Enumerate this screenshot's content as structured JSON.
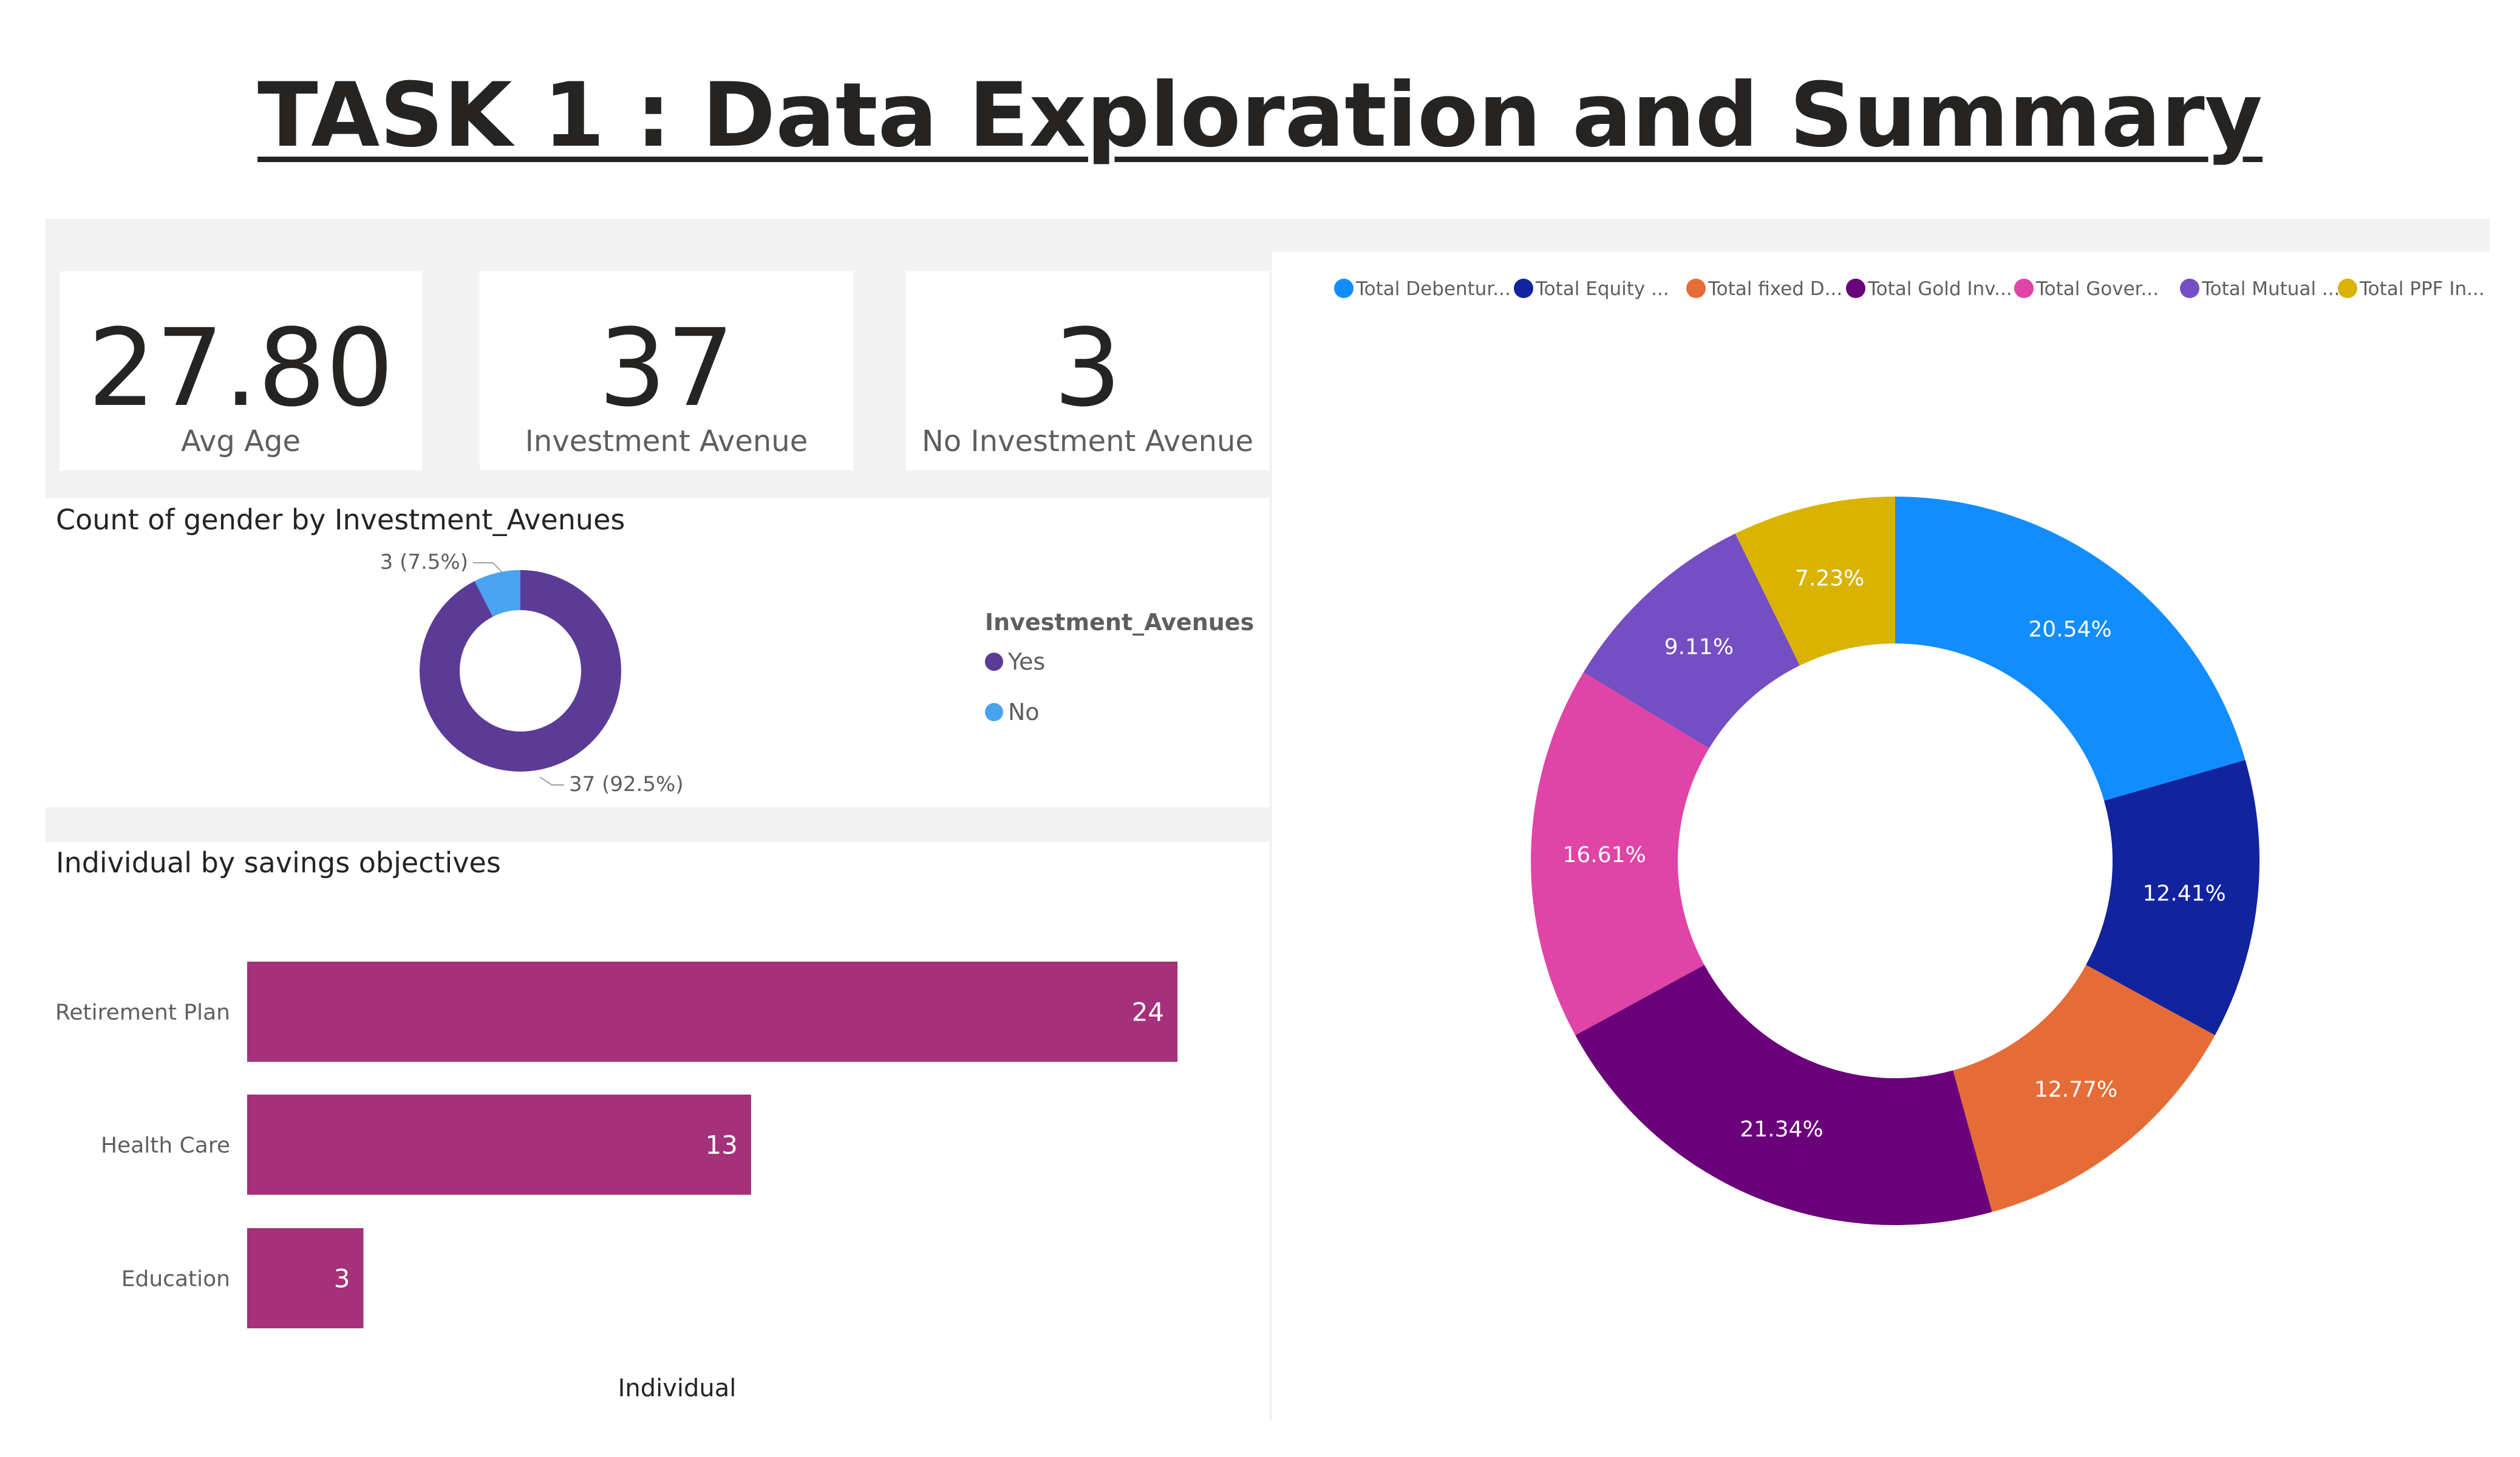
{
  "page": {
    "title": "TASK 1 : Data Exploration and Summary"
  },
  "kpis": [
    {
      "value": "27.80",
      "label": "Avg Age"
    },
    {
      "value": "37",
      "label": "Investment Avenue"
    },
    {
      "value": "3",
      "label": "No Investment Avenue"
    }
  ],
  "colors": {
    "yes": "#5b3b96",
    "no": "#4aa3f0",
    "bar": "#a4317a",
    "debentures": "#118dff",
    "equity": "#12239e",
    "fixed_deposits": "#e66c37",
    "gold": "#6b007b",
    "government_bonds": "#e044a7",
    "mutual_funds": "#744ec2",
    "ppf": "#d9b300"
  },
  "chart_data": [
    {
      "type": "pie",
      "variant": "donut",
      "title": "Count of gender by Investment_Avenues",
      "legend_title": "Investment_Avenues",
      "legend_position": "right",
      "categories": [
        "Yes",
        "No"
      ],
      "values": [
        37,
        3
      ],
      "data_labels": [
        "37 (92.5%)",
        "3 (7.5%)"
      ]
    },
    {
      "type": "bar",
      "orientation": "horizontal",
      "title": "Individual by savings objectives",
      "categories": [
        "Retirement Plan",
        "Health Care",
        "Education"
      ],
      "values": [
        24,
        13,
        3
      ],
      "xlabel": "Individual",
      "ylabel": "",
      "xlim": [
        0,
        25
      ]
    },
    {
      "type": "pie",
      "variant": "donut",
      "title": "",
      "legend_position": "top",
      "legend_labels": [
        "Total Debentur...",
        "Total Equity ...",
        "Total fixed D...",
        "Total Gold Inv...",
        "Total Gover...",
        "Total Mutual ...",
        "Total PPF In..."
      ],
      "values": [
        20.54,
        12.41,
        12.77,
        21.34,
        16.61,
        9.11,
        7.23
      ],
      "data_labels": [
        "20.54%",
        "12.41%",
        "12.77%",
        "21.34%",
        "16.61%",
        "9.11%",
        "7.23%"
      ]
    }
  ]
}
